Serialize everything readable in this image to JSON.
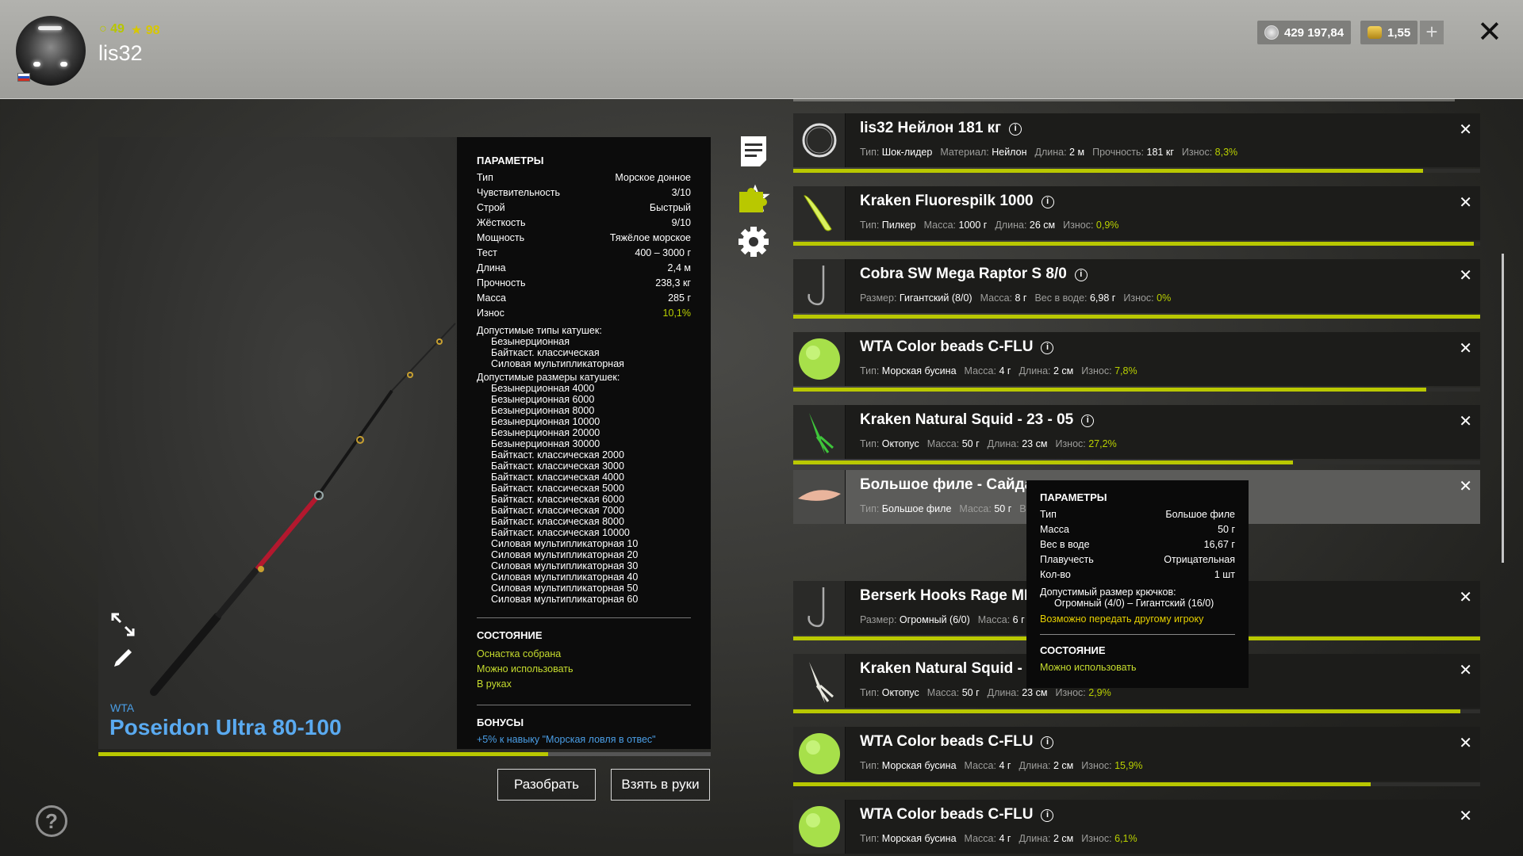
{
  "header": {
    "level": "49",
    "rating": "98",
    "username": "lis32",
    "silver": "429 197,84",
    "gold": "1,55",
    "plus_label": "+",
    "close_label": "✕"
  },
  "rod": {
    "brand": "WTA",
    "name": "Poseidon Ultra 80-100",
    "wear_fraction": 0.735
  },
  "params": {
    "title": "ПАРАМЕТРЫ",
    "rows": [
      {
        "label": "Тип",
        "value": "Морское донное"
      },
      {
        "label": "Чувствительность",
        "value": "3/10"
      },
      {
        "label": "Строй",
        "value": "Быстрый"
      },
      {
        "label": "Жёсткость",
        "value": "9/10"
      },
      {
        "label": "Мощность",
        "value": "Тяжёлое морское"
      },
      {
        "label": "Тест",
        "value": "400 – 3000 г"
      },
      {
        "label": "Длина",
        "value": "2,4 м"
      },
      {
        "label": "Прочность",
        "value": "238,3 кг"
      },
      {
        "label": "Масса",
        "value": "285 г"
      },
      {
        "label": "Износ",
        "value": "10,1%"
      }
    ],
    "reel_types_title": "Допустимые типы катушек:",
    "reel_types": [
      "Безынерционная",
      "Байткаст. классическая",
      "Силовая мультипликаторная"
    ],
    "reel_sizes_title": "Допустимые размеры катушек:",
    "reel_sizes": [
      "Безынерционная 4000",
      "Безынерционная 6000",
      "Безынерционная 8000",
      "Безынерционная 10000",
      "Безынерционная 20000",
      "Безынерционная 30000",
      "Байткаст. классическая 2000",
      "Байткаст. классическая 3000",
      "Байткаст. классическая 4000",
      "Байткаст. классическая 5000",
      "Байткаст. классическая 6000",
      "Байткаст. классическая 7000",
      "Байткаст. классическая 8000",
      "Байткаст. классическая 10000",
      "Силовая мультипликаторная 10",
      "Силовая мультипликаторная 20",
      "Силовая мультипликаторная 30",
      "Силовая мультипликаторная 40",
      "Силовая мультипликаторная 50",
      "Силовая мультипликаторная 60"
    ],
    "state_title": "СОСТОЯНИЕ",
    "states": [
      "Оснастка собрана",
      "Можно использовать",
      "В руках"
    ],
    "bonus_title": "БОНУСЫ",
    "bonus_text": "+5% к навыку \"Морская ловля в отвес\""
  },
  "buttons": {
    "disassemble": "Разобрать",
    "take": "Взять в руки",
    "help": "?"
  },
  "items": [
    {
      "name": "lis32 Нейлон 181 кг",
      "fields": [
        [
          "Тип:",
          "Шок-лидер"
        ],
        [
          "Материал:",
          "Нейлон"
        ],
        [
          "Длина:",
          "2 м"
        ],
        [
          "Прочность:",
          "181 кг"
        ]
      ],
      "wear_label": "Износ:",
      "wear": "8,3%",
      "wear_fraction": 0.917,
      "thumb": "coil"
    },
    {
      "name": "Kraken Fluorespilk 1000",
      "fields": [
        [
          "Тип:",
          "Пилкер"
        ],
        [
          "Масса:",
          "1000 г"
        ],
        [
          "Длина:",
          "26 см"
        ]
      ],
      "wear_label": "Износ:",
      "wear": "0,9%",
      "wear_fraction": 0.991,
      "thumb": "pilker"
    },
    {
      "name": "Cobra SW Mega Raptor S 8/0",
      "fields": [
        [
          "Размер:",
          "Гигантский (8/0)"
        ],
        [
          "Масса:",
          "8 г"
        ],
        [
          "Вес в воде:",
          "6,98 г"
        ]
      ],
      "wear_label": "Износ:",
      "wear": "0%",
      "wear_fraction": 1.0,
      "thumb": "hook"
    },
    {
      "name": "WTA Color beads C-FLU",
      "fields": [
        [
          "Тип:",
          "Морская бусина"
        ],
        [
          "Масса:",
          "4 г"
        ],
        [
          "Длина:",
          "2 см"
        ]
      ],
      "wear_label": "Износ:",
      "wear": "7,8%",
      "wear_fraction": 0.922,
      "thumb": "bead"
    },
    {
      "name": "Kraken Natural Squid - 23 - 05",
      "fields": [
        [
          "Тип:",
          "Октопус"
        ],
        [
          "Масса:",
          "50 г"
        ],
        [
          "Длина:",
          "23 см"
        ]
      ],
      "wear_label": "Износ:",
      "wear": "27,2%",
      "wear_fraction": 0.728,
      "thumb": "squid-green"
    },
    {
      "name": "Большое филе - Сайда",
      "fields": [
        [
          "Тип:",
          "Большое филе"
        ],
        [
          "Масса:",
          "50 г"
        ],
        [
          "Ве",
          ""
        ]
      ],
      "wear_label": "",
      "wear": "",
      "wear_fraction": null,
      "thumb": "fillet"
    },
    {
      "name": "Berserk Hooks Rage MR-A",
      "fields": [
        [
          "Размер:",
          "Огромный (6/0)"
        ],
        [
          "Масса:",
          "6 г"
        ]
      ],
      "wear_label": "",
      "wear": "",
      "wear_fraction": 1.0,
      "thumb": "hook"
    },
    {
      "name": "Kraken Natural Squid - 23",
      "fields": [
        [
          "Тип:",
          "Октопус"
        ],
        [
          "Масса:",
          "50 г"
        ],
        [
          "Длина:",
          "23 см"
        ]
      ],
      "wear_label": "Износ:",
      "wear": "2,9%",
      "wear_fraction": 0.971,
      "thumb": "squid-white"
    },
    {
      "name": "WTA Color beads C-FLU",
      "fields": [
        [
          "Тип:",
          "Морская бусина"
        ],
        [
          "Масса:",
          "4 г"
        ],
        [
          "Длина:",
          "2 см"
        ]
      ],
      "wear_label": "Износ:",
      "wear": "15,9%",
      "wear_fraction": 0.841,
      "thumb": "bead"
    },
    {
      "name": "WTA Color beads C-FLU",
      "fields": [
        [
          "Тип:",
          "Морская бусина"
        ],
        [
          "Масса:",
          "4 г"
        ],
        [
          "Длина:",
          "2 см"
        ]
      ],
      "wear_label": "Износ:",
      "wear": "6,1%",
      "wear_fraction": null,
      "thumb": "bead"
    }
  ],
  "tooltip": {
    "title": "ПАРАМЕТРЫ",
    "rows": [
      {
        "label": "Тип",
        "value": "Большое филе"
      },
      {
        "label": "Масса",
        "value": "50 г"
      },
      {
        "label": "Вес в воде",
        "value": "16,67 г"
      },
      {
        "label": "Плавучесть",
        "value": "Отрицательная"
      },
      {
        "label": "Кол-во",
        "value": "1 шт"
      }
    ],
    "hook_title": "Допустимый размер крючков:",
    "hook_range": "Огромный (4/0) – Гигантский (16/0)",
    "transfer": "Возможно передать другому игроку",
    "state_title": "СОСТОЯНИЕ",
    "state": "Можно использовать"
  },
  "colors": {
    "accent_green": "#b9c800",
    "brand_blue": "#5aaaf0",
    "yellow": "#e6d000"
  }
}
